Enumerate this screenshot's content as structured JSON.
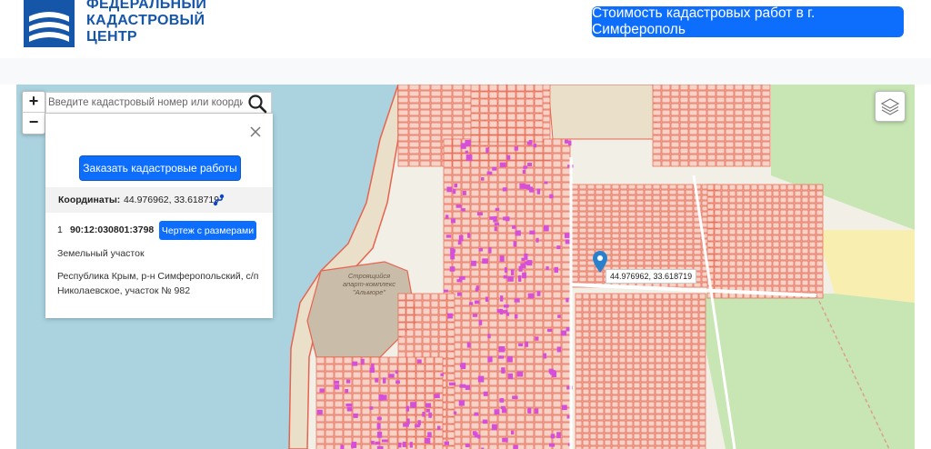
{
  "header": {
    "logo_lines": [
      "ФЕДЕРАЛЬНЫЙ",
      "КАДАСТРОВЫЙ",
      "ЦЕНТР"
    ],
    "cta_label": "Стоимость кадастровых работ в г. Симферополь"
  },
  "map": {
    "zoom_in": "+",
    "zoom_out": "−",
    "search_placeholder": "Введите кадастровый номер или координаты",
    "marker_label": "44.976962, 33.618719",
    "area_label": "Строящийся апарт-комплекс \"Альморе\"",
    "colors": {
      "water": "#aad3df",
      "land": "#f2efe6",
      "parcel_stroke": "#e8634f",
      "parcel_fill": "#f6d3c6",
      "building": "#d64fd8",
      "green": "#c7e6b4",
      "accent": "#0d6efd"
    }
  },
  "panel": {
    "order_label": "Заказать кадастровые работы",
    "coords_label": "Координаты:",
    "coords_value": "44.976962, 33.618719",
    "result": {
      "index": "1",
      "cadnum": "90:12:030801:3798",
      "drawing_label": "Чертеж с размерами",
      "type": "Земельный участок",
      "address": "Республика Крым, р-н Симферопольский, с/п Николаевское, участок № 982"
    }
  }
}
